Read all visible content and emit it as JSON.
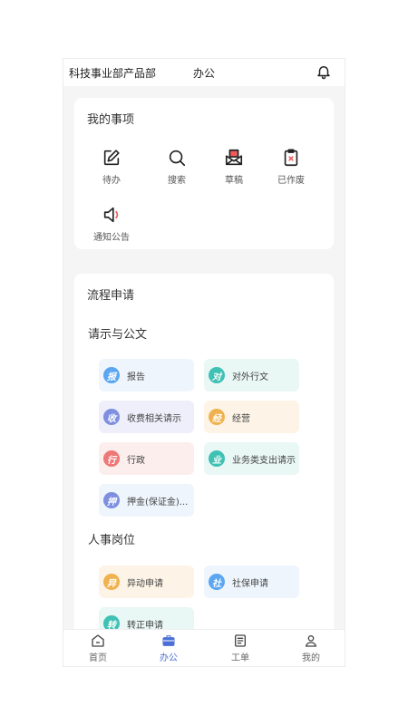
{
  "header": {
    "department": "科技事业部产品部",
    "title": "办公"
  },
  "my_items": {
    "title": "我的事项",
    "items": [
      {
        "label": "待办",
        "icon": "edit-icon"
      },
      {
        "label": "搜索",
        "icon": "search-icon"
      },
      {
        "label": "草稿",
        "icon": "draft-envelope-icon"
      },
      {
        "label": "已作废",
        "icon": "void-clipboard-icon"
      },
      {
        "label": "通知公告",
        "icon": "speaker-icon"
      }
    ]
  },
  "process": {
    "title": "流程申请",
    "sections": [
      {
        "title": "请示与公文",
        "chips": [
          {
            "badge": "报",
            "label": "报告",
            "color": "#5ba6f0",
            "bg": "#eef5fd"
          },
          {
            "badge": "对",
            "label": "对外行文",
            "color": "#3fc1b4",
            "bg": "#e9f7f5"
          },
          {
            "badge": "收",
            "label": "收费相关请示",
            "color": "#7e8fe0",
            "bg": "#eeeffb"
          },
          {
            "badge": "经",
            "label": "经营",
            "color": "#f0b24f",
            "bg": "#fdf4e7"
          },
          {
            "badge": "行",
            "label": "行政",
            "color": "#ee7777",
            "bg": "#fdeeee"
          },
          {
            "badge": "业",
            "label": "业务类支出请示",
            "color": "#3fc1b4",
            "bg": "#e9f7f5"
          },
          {
            "badge": "押",
            "label": "押金(保证金)...",
            "color": "#7e8fe0",
            "bg": "#eef5fd"
          }
        ]
      },
      {
        "title": "人事岗位",
        "chips": [
          {
            "badge": "异",
            "label": "异动申请",
            "color": "#f0b24f",
            "bg": "#fdf4e7"
          },
          {
            "badge": "社",
            "label": "社保申请",
            "color": "#5ba6f0",
            "bg": "#eef5fd"
          },
          {
            "badge": "转",
            "label": "转正申请",
            "color": "#3fc1b4",
            "bg": "#e9f7f5"
          }
        ]
      }
    ]
  },
  "tabbar": {
    "tabs": [
      {
        "label": "首页",
        "icon": "home-icon"
      },
      {
        "label": "办公",
        "icon": "briefcase-icon",
        "active": true
      },
      {
        "label": "工单",
        "icon": "document-icon"
      },
      {
        "label": "我的",
        "icon": "user-icon"
      }
    ]
  },
  "colors": {
    "accent": "#4b6fd6",
    "page_bg": "#f5f5f5",
    "card_bg": "#ffffff"
  }
}
